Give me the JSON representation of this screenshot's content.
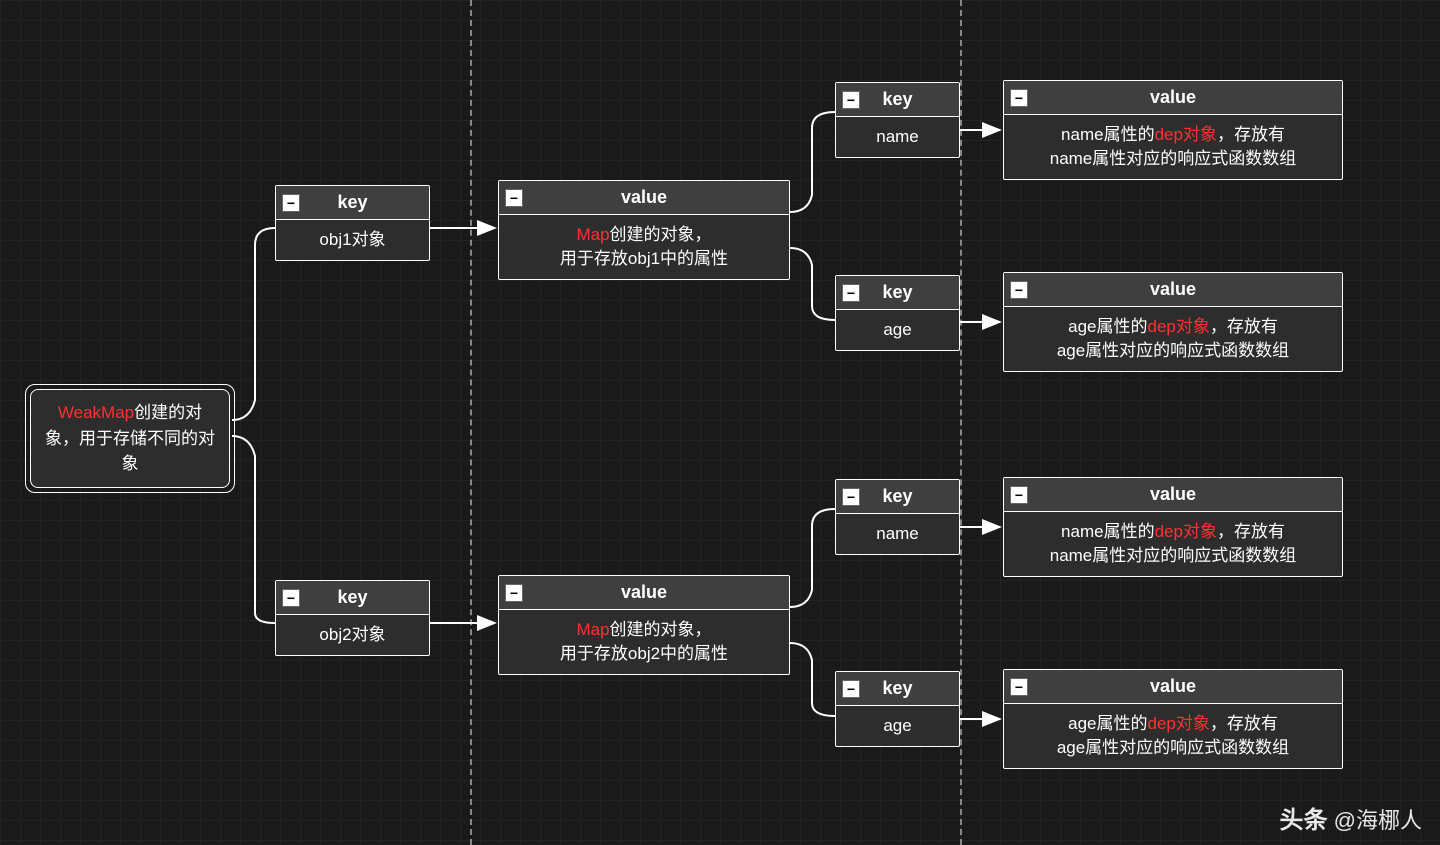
{
  "root": {
    "highlight": "WeakMap",
    "text": "创建的对象，用于存储不同的对象"
  },
  "col1": [
    {
      "header": "key",
      "body": "obj1对象"
    },
    {
      "header": "key",
      "body": "obj2对象"
    }
  ],
  "col2": [
    {
      "header": "value",
      "highlight": "Map",
      "body1": "创建的对象，",
      "body2": "用于存放obj1中的属性"
    },
    {
      "header": "value",
      "highlight": "Map",
      "body1": "创建的对象，",
      "body2": "用于存放obj2中的属性"
    }
  ],
  "col3": [
    {
      "header": "key",
      "body": "name"
    },
    {
      "header": "key",
      "body": "age"
    },
    {
      "header": "key",
      "body": "name"
    },
    {
      "header": "key",
      "body": "age"
    }
  ],
  "col4": [
    {
      "header": "value",
      "pre": "name属性的",
      "highlight": "dep对象",
      "mid": "，存放有",
      "line2": "name属性对应的响应式函数数组"
    },
    {
      "header": "value",
      "pre": "age属性的",
      "highlight": "dep对象",
      "mid": "，存放有",
      "line2": "age属性对应的响应式函数数组"
    },
    {
      "header": "value",
      "pre": "name属性的",
      "highlight": "dep对象",
      "mid": "，存放有",
      "line2": "name属性对应的响应式函数数组"
    },
    {
      "header": "value",
      "pre": "age属性的",
      "highlight": "dep对象",
      "mid": "，存放有",
      "line2": "age属性对应的响应式函数数组"
    }
  ],
  "watermark": {
    "label": "头条",
    "handle": "@海梛人"
  }
}
